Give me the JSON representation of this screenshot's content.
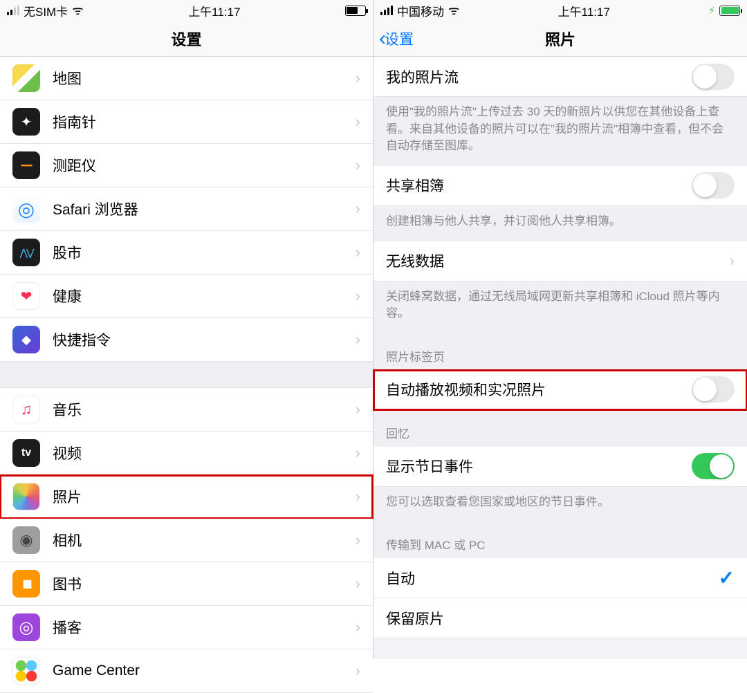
{
  "left": {
    "status": {
      "carrier": "无SIM卡",
      "time": "上午11:17"
    },
    "nav_title": "设置",
    "group1": [
      {
        "label": "地图"
      },
      {
        "label": "指南针"
      },
      {
        "label": "测距仪"
      },
      {
        "label": "Safari 浏览器"
      },
      {
        "label": "股市"
      },
      {
        "label": "健康"
      },
      {
        "label": "快捷指令"
      }
    ],
    "group2": [
      {
        "label": "音乐"
      },
      {
        "label": "视频"
      },
      {
        "label": "照片",
        "highlighted": true
      },
      {
        "label": "相机"
      },
      {
        "label": "图书"
      },
      {
        "label": "播客"
      },
      {
        "label": "Game Center"
      }
    ]
  },
  "right": {
    "status": {
      "carrier": "中国移动",
      "time": "上午11:17"
    },
    "nav_back": "设置",
    "nav_title": "照片",
    "rows": {
      "my_photo_stream": {
        "label": "我的照片流",
        "on": false
      },
      "my_photo_stream_footer": "使用\"我的照片流\"上传过去 30 天的新照片以供您在其他设备上查看。来自其他设备的照片可以在\"我的照片流\"相簿中查看，但不会自动存储至图库。",
      "shared_albums": {
        "label": "共享相簿",
        "on": false
      },
      "shared_albums_footer": "创建相簿与他人共享，并订阅他人共享相簿。",
      "cellular": {
        "label": "无线数据"
      },
      "cellular_footer": "关闭蜂窝数据，通过无线局域网更新共享相簿和 iCloud 照片等内容。",
      "photos_tab_header": "照片标签页",
      "autoplay": {
        "label": "自动播放视频和实况照片",
        "on": false,
        "highlighted": true
      },
      "memories_header": "回忆",
      "holiday": {
        "label": "显示节日事件",
        "on": true
      },
      "holiday_footer": "您可以选取查看您国家或地区的节日事件。",
      "transfer_header": "传输到 MAC 或 PC",
      "transfer_auto": {
        "label": "自动",
        "checked": true
      },
      "transfer_keep": {
        "label": "保留原片",
        "checked": false
      }
    }
  }
}
